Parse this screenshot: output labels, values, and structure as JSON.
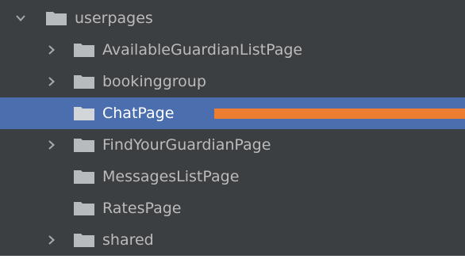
{
  "colors": {
    "background": "#3c3f41",
    "text": "#bbbbbb",
    "selection": "#4b6eaf",
    "selected_text": "#ffffff",
    "folder_icon": "#b8bbbe",
    "highlight_marker": "#ed7d31"
  },
  "tree": {
    "items": [
      {
        "label": "userpages",
        "level": 0,
        "expandable": true,
        "expanded": true,
        "selected": false,
        "icon": "folder-icon"
      },
      {
        "label": "AvailableGuardianListPage",
        "level": 1,
        "expandable": true,
        "expanded": false,
        "selected": false,
        "icon": "folder-icon"
      },
      {
        "label": "bookinggroup",
        "level": 1,
        "expandable": true,
        "expanded": false,
        "selected": false,
        "icon": "folder-icon"
      },
      {
        "label": "ChatPage",
        "level": 1,
        "expandable": false,
        "expanded": false,
        "selected": true,
        "icon": "folder-icon"
      },
      {
        "label": "FindYourGuardianPage",
        "level": 1,
        "expandable": true,
        "expanded": false,
        "selected": false,
        "icon": "folder-icon"
      },
      {
        "label": "MessagesListPage",
        "level": 1,
        "expandable": false,
        "expanded": false,
        "selected": false,
        "icon": "folder-icon"
      },
      {
        "label": "RatesPage",
        "level": 1,
        "expandable": false,
        "expanded": false,
        "selected": false,
        "icon": "folder-icon"
      },
      {
        "label": "shared",
        "level": 1,
        "expandable": true,
        "expanded": false,
        "selected": false,
        "icon": "folder-icon"
      }
    ]
  }
}
